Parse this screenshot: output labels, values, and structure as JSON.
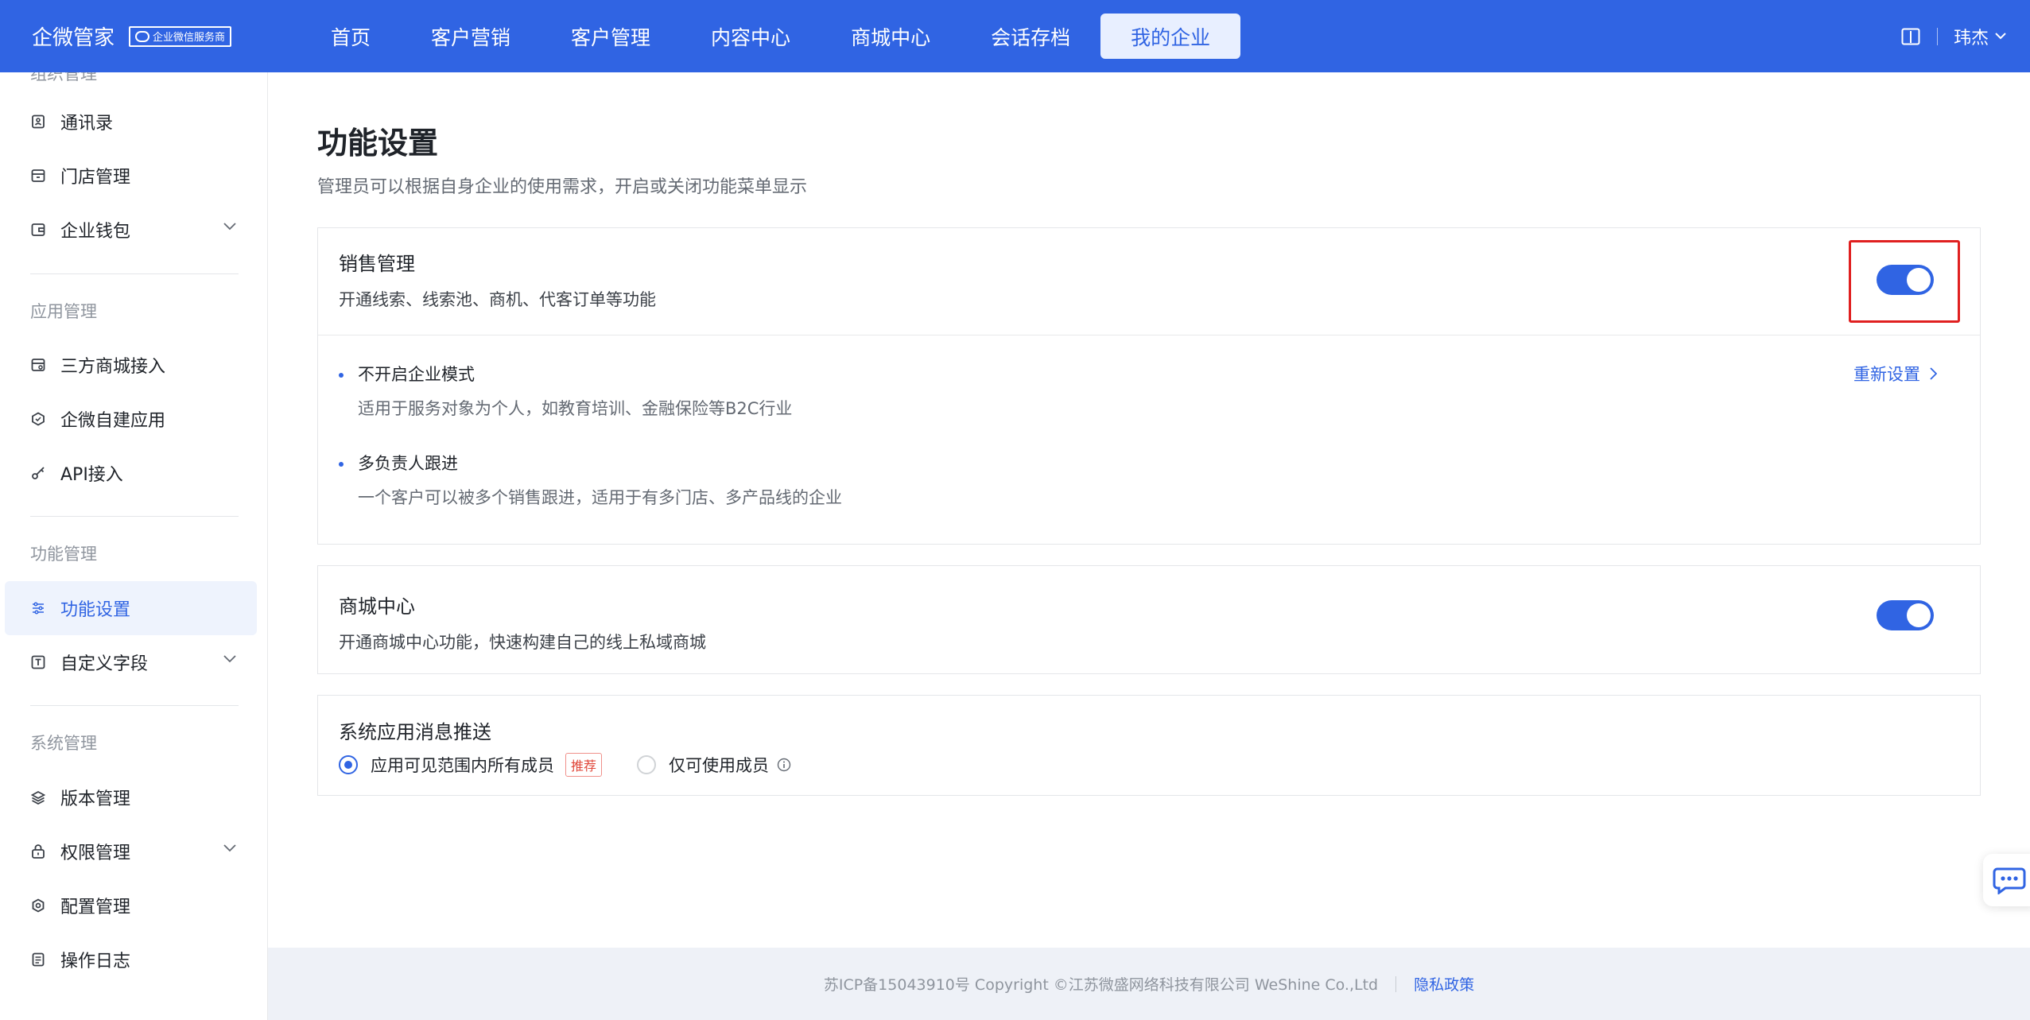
{
  "app": {
    "brand_name": "企微管家",
    "brand_badge": "企业微信服务商",
    "user_name": "玮杰"
  },
  "nav": {
    "items": [
      "首页",
      "客户营销",
      "客户管理",
      "内容中心",
      "商城中心",
      "会话存档",
      "我的企业"
    ],
    "active_index": 6
  },
  "sidebar": {
    "cut_group": "组织管理",
    "items_top": [
      {
        "label": "通讯录",
        "icon": "contacts-icon"
      },
      {
        "label": "门店管理",
        "icon": "store-icon"
      },
      {
        "label": "企业钱包",
        "icon": "wallet-icon",
        "expandable": true
      }
    ],
    "group_app": "应用管理",
    "items_app": [
      {
        "label": "三方商城接入",
        "icon": "mall-icon"
      },
      {
        "label": "企微自建应用",
        "icon": "app-icon"
      },
      {
        "label": "API接入",
        "icon": "key-icon"
      }
    ],
    "group_func": "功能管理",
    "items_func": [
      {
        "label": "功能设置",
        "icon": "sliders-icon",
        "active": true
      },
      {
        "label": "自定义字段",
        "icon": "text-field-icon",
        "expandable": true
      }
    ],
    "group_sys": "系统管理",
    "items_sys": [
      {
        "label": "版本管理",
        "icon": "layers-icon"
      },
      {
        "label": "权限管理",
        "icon": "lock-icon",
        "expandable": true
      },
      {
        "label": "配置管理",
        "icon": "settings-icon"
      },
      {
        "label": "操作日志",
        "icon": "log-icon"
      }
    ]
  },
  "main": {
    "title": "功能设置",
    "description": "管理员可以根据自身企业的使用需求，开启或关闭功能菜单显示",
    "sales": {
      "title": "销售管理",
      "subtitle": "开通线索、线索池、商机、代客订单等功能",
      "enabled": true,
      "reset_label": "重新设置",
      "options": [
        {
          "title": "不开启企业模式",
          "desc": "适用于服务对象为个人，如教育培训、金融保险等B2C行业"
        },
        {
          "title": "多负责人跟进",
          "desc": "一个客户可以被多个销售跟进，适用于有多门店、多产品线的企业"
        }
      ]
    },
    "mall": {
      "title": "商城中心",
      "subtitle": "开通商城中心功能，快速构建自己的线上私域商城",
      "enabled": true
    },
    "push": {
      "title": "系统应用消息推送",
      "option_all": "应用可见范围内所有成员",
      "recommend_tag": "推荐",
      "option_limited": "仅可使用成员",
      "selected": "option_all"
    }
  },
  "footer": {
    "copyright": "苏ICP备15043910号 Copyright ©江苏微盛网络科技有限公司 WeShine Co.,Ltd",
    "privacy": "隐私政策"
  },
  "colors": {
    "primary": "#3064e3",
    "highlight": "#e02020",
    "footer_bg": "#eef1f7"
  }
}
